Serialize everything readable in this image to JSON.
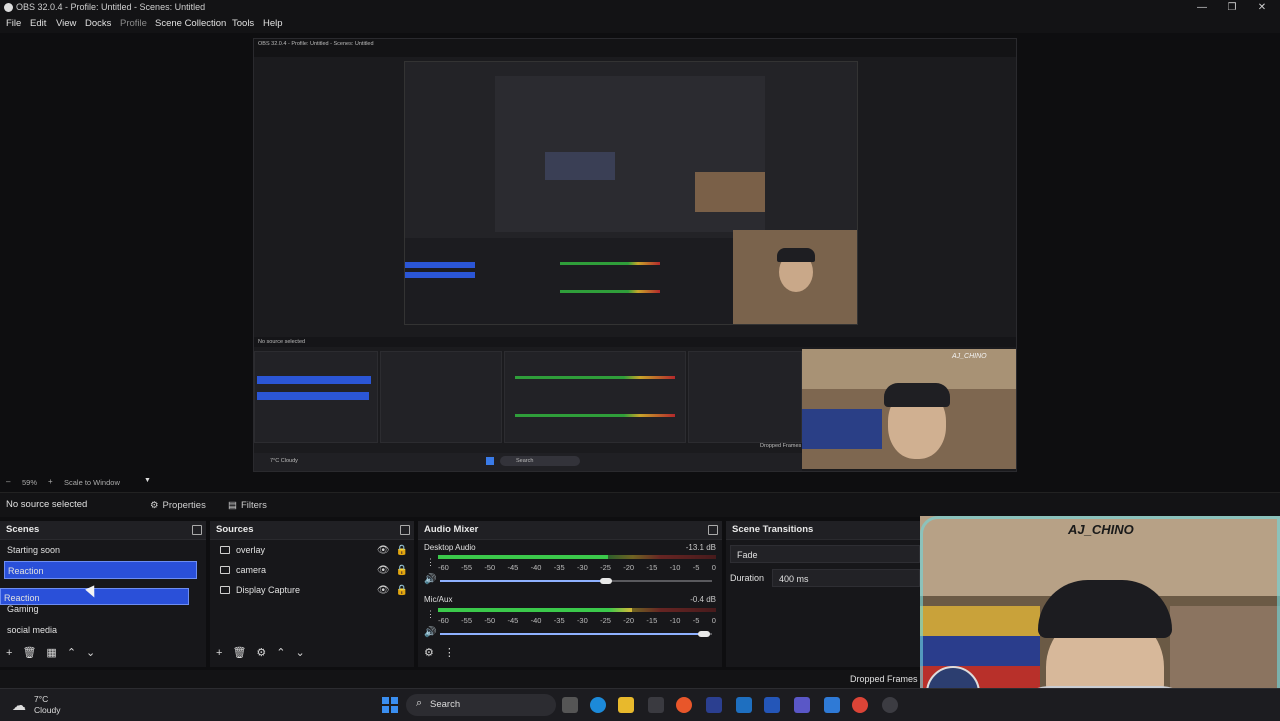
{
  "window": {
    "title": "OBS 32.0.4 - Profile: Untitled - Scenes: Untitled",
    "controls": [
      "—",
      "❐",
      "✕"
    ]
  },
  "menu": [
    "File",
    "Edit",
    "View",
    "Docks",
    "Profile",
    "Scene Collection",
    "Tools",
    "Help"
  ],
  "preview": {
    "zoom_label": "59%",
    "scale_mode": "Scale to Window",
    "nested_title": "OBS 32.0.4 - Profile: Untitled - Scenes: Untitled",
    "nested_status": "No source selected",
    "nested_dropped": "Dropped Frames",
    "nested_weather": "7°C Cloudy",
    "nested_search": "Search",
    "nested_webcam_label": "AJ_CHINO"
  },
  "context": {
    "status": "No source selected",
    "properties_label": "Properties",
    "filters_label": "Filters"
  },
  "scenes": {
    "title": "Scenes",
    "items": [
      "Starting soon",
      "Reaction",
      "Reaction",
      "Gaming",
      "social media"
    ],
    "selected_index": 1
  },
  "sources": {
    "title": "Sources",
    "items": [
      {
        "name": "overlay",
        "icon": "overlay-icon"
      },
      {
        "name": "camera",
        "icon": "camera-icon"
      },
      {
        "name": "Display Capture",
        "icon": "display-icon"
      }
    ]
  },
  "audio_mixer": {
    "title": "Audio Mixer",
    "scale": [
      "-60",
      "-55",
      "-50",
      "-45",
      "-40",
      "-35",
      "-30",
      "-25",
      "-20",
      "-15",
      "-10",
      "-5",
      "0"
    ],
    "channels": [
      {
        "name": "Desktop Audio",
        "db": "-13.1 dB",
        "level": 0.62,
        "volume": 0.6
      },
      {
        "name": "Mic/Aux",
        "db": "-0.4 dB",
        "level": 0.66,
        "volume": 0.97
      }
    ]
  },
  "transitions": {
    "title": "Scene Transitions",
    "type": "Fade",
    "duration_label": "Duration",
    "duration_value": "400 ms"
  },
  "webcam": {
    "overlay_text": "AJ_CHINO"
  },
  "status": {
    "dropped_frames": "Dropped Frames"
  },
  "taskbar": {
    "weather_temp": "7°C",
    "weather_desc": "Cloudy",
    "search_label": "Search"
  },
  "colors": {
    "accent": "#2a50d9",
    "meter_green": "#2e9a3b",
    "meter_yellow": "#b8a22a",
    "meter_red": "#a8302a",
    "background": "#0e0e10",
    "dock": "#17171a"
  }
}
